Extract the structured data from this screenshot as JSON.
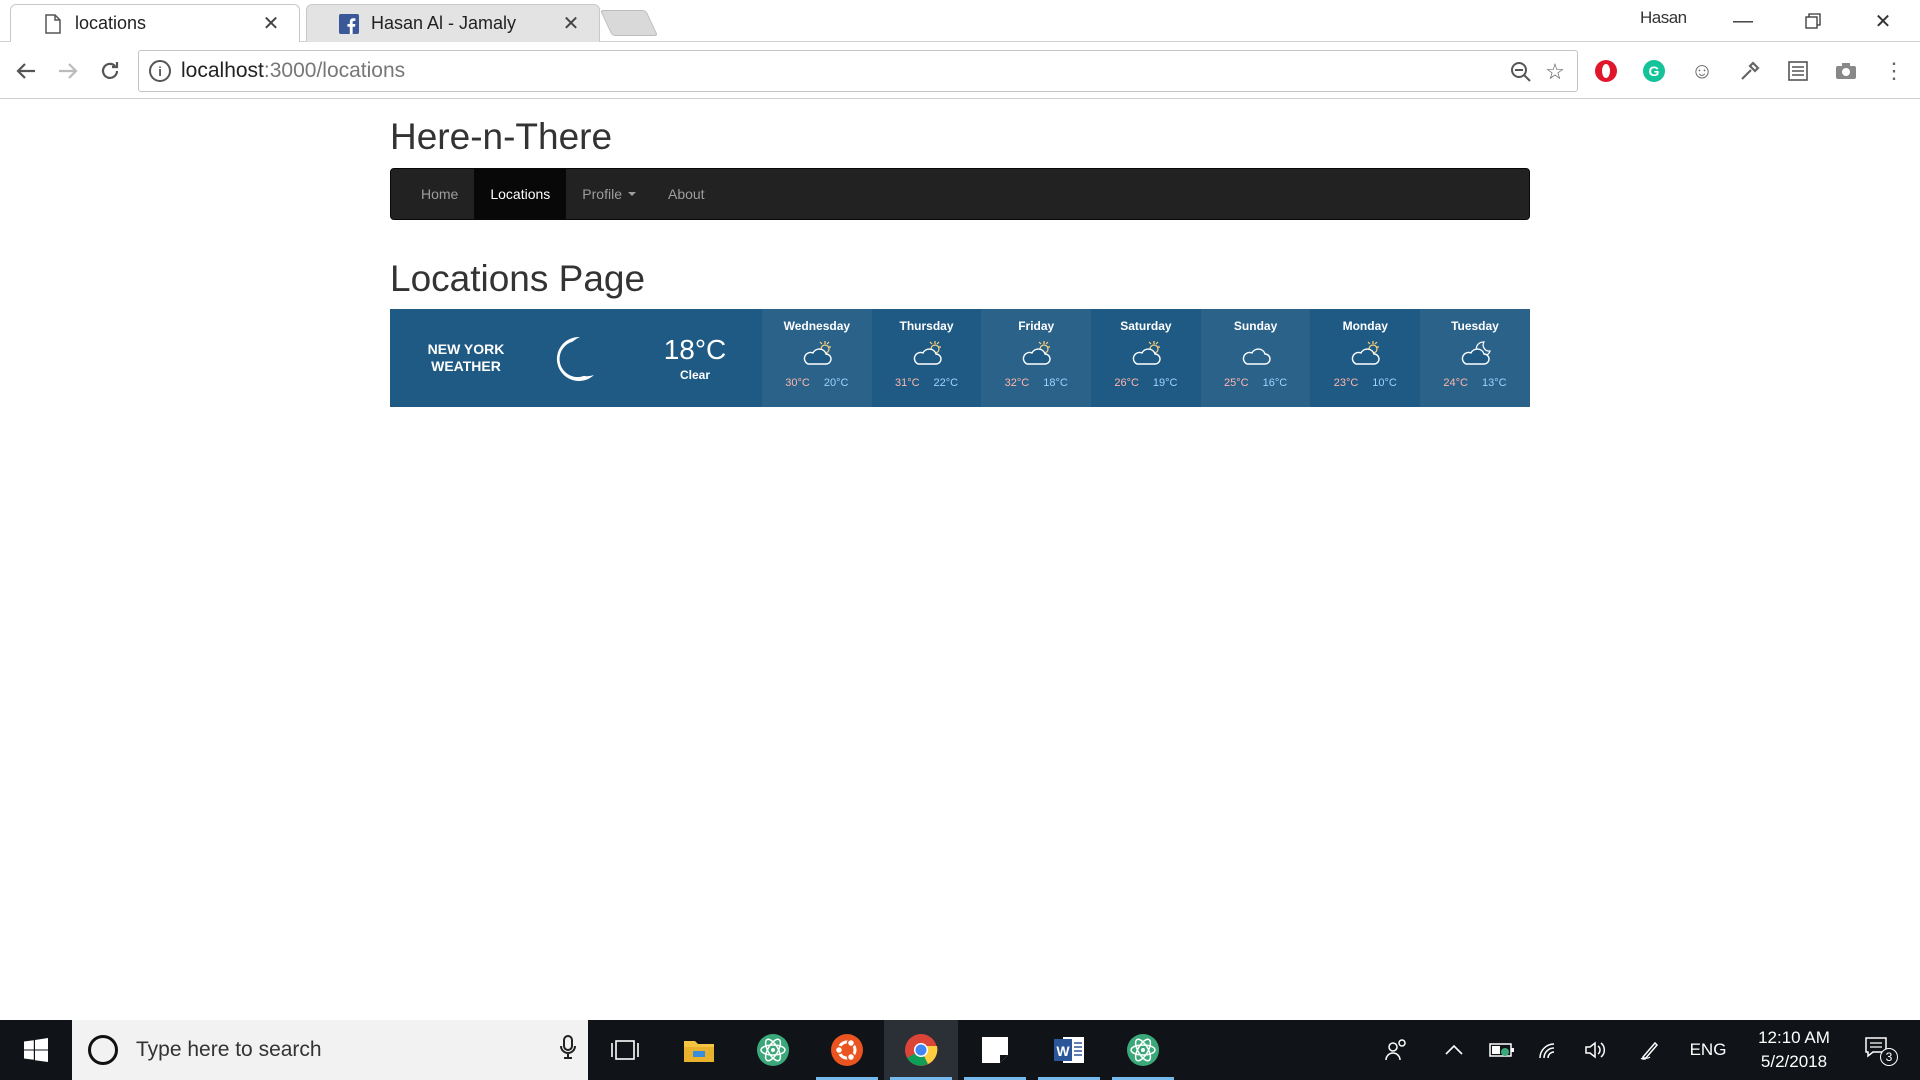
{
  "browser": {
    "tabs": [
      {
        "title": "locations",
        "icon": "page-icon"
      },
      {
        "title": "Hasan Al - Jamaly",
        "icon": "facebook-icon"
      }
    ],
    "profile_name": "Hasan",
    "url_host": "localhost",
    "url_path": ":3000/locations"
  },
  "site": {
    "title": "Here-n-There",
    "nav": {
      "home": "Home",
      "locations": "Locations",
      "profile": "Profile",
      "about": "About"
    },
    "page_heading": "Locations Page"
  },
  "weather": {
    "city_line1": "NEW YORK",
    "city_line2": "WEATHER",
    "current_temp": "18°C",
    "current_condition": "Clear",
    "current_icon": "moon-icon",
    "days": [
      {
        "name": "Wednesday",
        "high": "30°C",
        "low": "20°C",
        "icon": "partly-cloudy-icon"
      },
      {
        "name": "Thursday",
        "high": "31°C",
        "low": "22°C",
        "icon": "partly-cloudy-icon"
      },
      {
        "name": "Friday",
        "high": "32°C",
        "low": "18°C",
        "icon": "partly-cloudy-icon"
      },
      {
        "name": "Saturday",
        "high": "26°C",
        "low": "19°C",
        "icon": "partly-cloudy-icon"
      },
      {
        "name": "Sunday",
        "high": "25°C",
        "low": "16°C",
        "icon": "cloud-icon"
      },
      {
        "name": "Monday",
        "high": "23°C",
        "low": "10°C",
        "icon": "partly-cloudy-icon"
      },
      {
        "name": "Tuesday",
        "high": "24°C",
        "low": "13°C",
        "icon": "partly-cloudy-night-icon"
      }
    ],
    "colors": {
      "background": "#1f5a84",
      "high": "#ffb5a8",
      "low": "#9fd2ff"
    }
  },
  "taskbar": {
    "search_placeholder": "Type here to search",
    "language": "ENG",
    "time": "12:10 AM",
    "date": "5/2/2018",
    "notification_count": "3"
  }
}
